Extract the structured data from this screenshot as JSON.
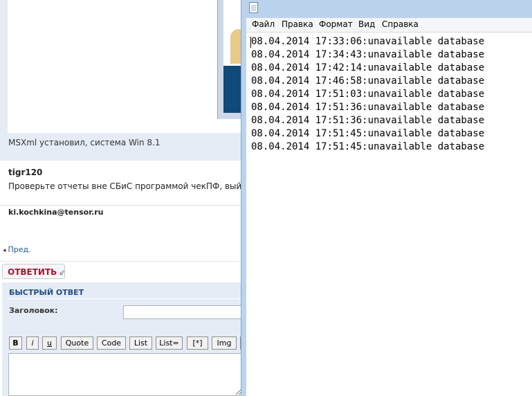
{
  "forum": {
    "post_caption": "MSXml установил, система Win 8.1",
    "reply": {
      "author": "tigr120",
      "text": "Проверьте отчеты вне СБиС программой чекПФ, выйде"
    },
    "signature_email": "ki.kochkina@tensor.ru",
    "prev_link": "Пред.",
    "reply_button": "ОТВЕТИТЬ",
    "quick_reply": {
      "title": "БЫСТРЫЙ ОТВЕТ",
      "subject_label": "Заголовок:",
      "subject_value": "",
      "bbcode_buttons": [
        "B",
        "i",
        "u",
        "Quote",
        "Code",
        "List",
        "List=",
        "[*]",
        "Img"
      ],
      "message_value": ""
    }
  },
  "notepad": {
    "menu": [
      "Файл",
      "Правка",
      "Формат",
      "Вид",
      "Справка"
    ],
    "lines": [
      "08.04.2014 17:33:06:unavailable database",
      "08.04.2014 17:34:43:unavailable database",
      "08.04.2014 17:42:14:unavailable database",
      "08.04.2014 17:46:58:unavailable database",
      "08.04.2014 17:51:03:unavailable database",
      "08.04.2014 17:51:36:unavailable database",
      "08.04.2014 17:51:36:unavailable database",
      "08.04.2014 17:51:45:unavailable database",
      "08.04.2014 17:51:45:unavailable database"
    ]
  },
  "colors": {
    "reply_button_text": "#b0112d",
    "link": "#1a5a96",
    "panel_title": "#1d4f86",
    "window_frame": "#bcd3ee"
  }
}
